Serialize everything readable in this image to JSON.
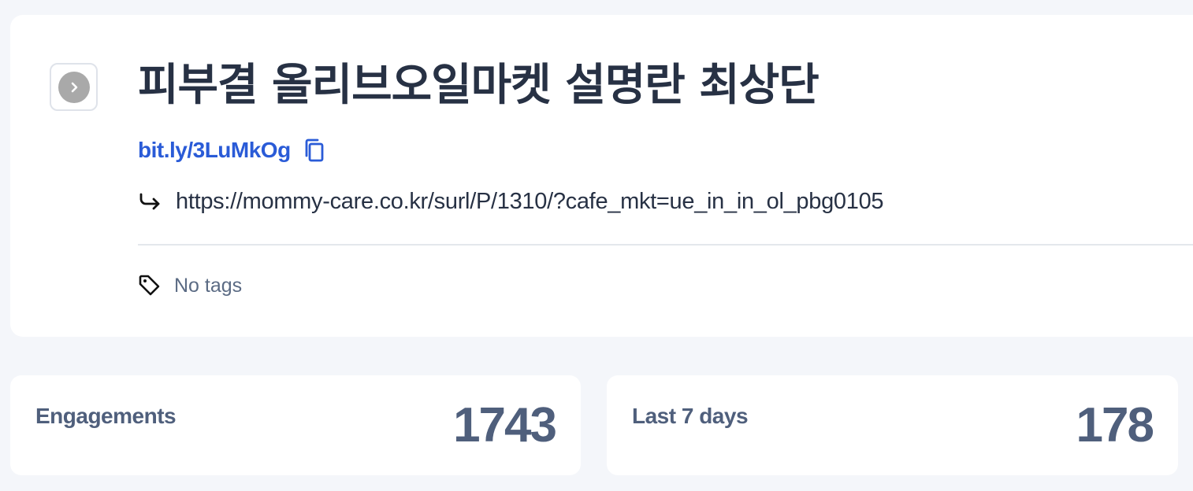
{
  "link": {
    "title": "피부결 올리브오일마켓 설명란 최상단",
    "short_url": "bit.ly/3LuMkOg",
    "destination_url": "https://mommy-care.co.kr/surl/P/1310/?cafe_mkt=ue_in_in_ol_pbg0105",
    "tags_text": "No tags"
  },
  "icons": {
    "collapse": "chevron-right-icon",
    "copy": "copy-icon",
    "redirect": "redirect-arrow-icon",
    "tag": "tag-icon"
  },
  "stats": {
    "engagements_label": "Engagements",
    "engagements_value": "1743",
    "last7_label": "Last 7 days",
    "last7_value": "178"
  },
  "colors": {
    "link_blue": "#2a5bd7",
    "stat_text": "#4f5f7c",
    "background": "#f4f6fa"
  }
}
